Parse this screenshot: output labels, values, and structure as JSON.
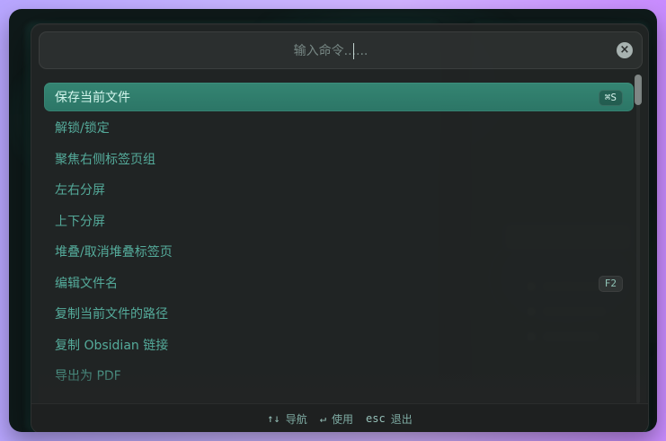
{
  "palette": {
    "search": {
      "placeholder": "输入命令......",
      "value": "",
      "clear_icon": "close-circle-icon"
    },
    "items": [
      {
        "label": "保存当前文件",
        "shortcut": "⌘S",
        "selected": true
      },
      {
        "label": "解锁/锁定",
        "shortcut": "",
        "selected": false
      },
      {
        "label": "聚焦右侧标签页组",
        "shortcut": "",
        "selected": false
      },
      {
        "label": "左右分屏",
        "shortcut": "",
        "selected": false
      },
      {
        "label": "上下分屏",
        "shortcut": "",
        "selected": false
      },
      {
        "label": "堆叠/取消堆叠标签页",
        "shortcut": "",
        "selected": false
      },
      {
        "label": "编辑文件名",
        "shortcut": "F2",
        "selected": false
      },
      {
        "label": "复制当前文件的路径",
        "shortcut": "",
        "selected": false
      },
      {
        "label": "复制 Obsidian 链接",
        "shortcut": "",
        "selected": false
      },
      {
        "label": "导出为 PDF",
        "shortcut": "",
        "selected": false
      }
    ],
    "footer": {
      "navigate_key": "↑↓",
      "navigate_label": "导航",
      "use_key": "↵",
      "use_label": "使用",
      "exit_key": "esc",
      "exit_label": "退出"
    },
    "colors": {
      "accent": "#2E8472",
      "text_teal": "#60C8B4"
    }
  }
}
